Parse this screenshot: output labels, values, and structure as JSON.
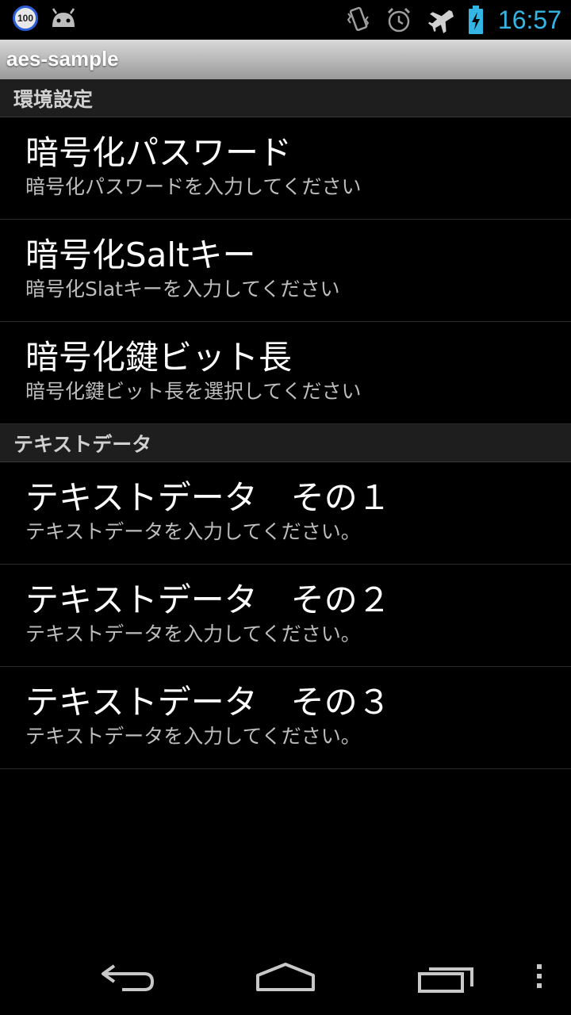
{
  "status_bar": {
    "battery_badge": "100",
    "time": "16:57",
    "icons": [
      "battery-level-badge-icon",
      "android-robot-icon",
      "vibrate-icon",
      "alarm-icon",
      "airplane-icon",
      "battery-charging-icon"
    ]
  },
  "action_bar": {
    "title": "aes-sample"
  },
  "sections": [
    {
      "header": "環境設定",
      "items": [
        {
          "title": "暗号化パスワード",
          "summary": "暗号化パスワードを入力してください"
        },
        {
          "title": "暗号化Saltキー",
          "summary": "暗号化Slatキーを入力してください"
        },
        {
          "title": "暗号化鍵ビット長",
          "summary": "暗号化鍵ビット長を選択してください"
        }
      ]
    },
    {
      "header": "テキストデータ",
      "items": [
        {
          "title": "テキストデータ　その１",
          "summary": "テキストデータを入力してください。"
        },
        {
          "title": "テキストデータ　その２",
          "summary": "テキストデータを入力してください。"
        },
        {
          "title": "テキストデータ　その３",
          "summary": "テキストデータを入力してください。"
        }
      ]
    }
  ],
  "nav_bar": {
    "icons": [
      "back-icon",
      "home-icon",
      "recent-apps-icon",
      "overflow-menu-icon"
    ]
  },
  "colors": {
    "clock": "#33b5e5",
    "background": "#000000"
  }
}
